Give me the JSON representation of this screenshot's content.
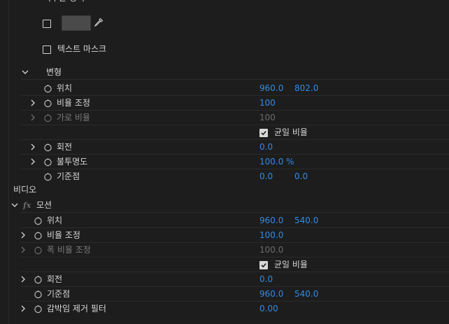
{
  "panel": {
    "top_partial_label": "이두운 영역",
    "mask_toggle_label": "",
    "text_mask_label": "텍스트 마스크",
    "transform": {
      "label": "변형",
      "rows": [
        {
          "label": "위치",
          "v1": "960.0",
          "v2": "802.0"
        },
        {
          "label": "비율 조정",
          "v1": "100"
        },
        {
          "label": "가로 비율",
          "v1": "100"
        },
        {
          "label": "균일 비율"
        },
        {
          "label": "회전",
          "v1": "0.0"
        },
        {
          "label": "불투명도",
          "v1": "100.0 %"
        },
        {
          "label": "기준점",
          "v1": "0.0",
          "v2": "0.0"
        }
      ]
    },
    "video": {
      "label": "비디오",
      "fx_glyph": "fx",
      "motion": {
        "label": "모션",
        "rows": [
          {
            "label": "위치",
            "v1": "960.0",
            "v2": "540.0"
          },
          {
            "label": "비율 조정",
            "v1": "100.0"
          },
          {
            "label": "폭 비율 조정",
            "v1": "100.0"
          },
          {
            "label": "균일 비율"
          },
          {
            "label": "회전",
            "v1": "0.0"
          },
          {
            "label": "기준점",
            "v1": "960.0",
            "v2": "540.0"
          },
          {
            "label": "감박임 제거 필터",
            "v1": "0.00"
          }
        ]
      }
    }
  },
  "colors": {
    "background": "#1d1d1d",
    "value_blue": "#2d8ceb",
    "text": "#d7d7d7",
    "disabled": "#6b6b6b"
  }
}
